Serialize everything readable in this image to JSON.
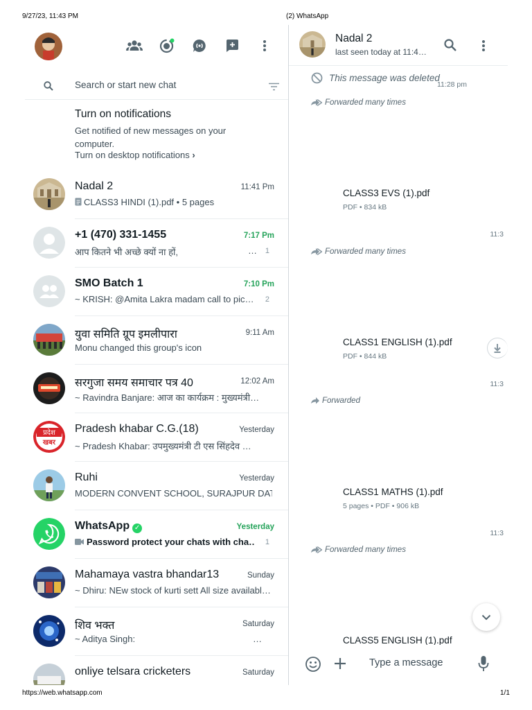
{
  "print": {
    "datetime": "9/27/23, 11:43 PM",
    "tab_title": "(2) WhatsApp",
    "url": "https://web.whatsapp.com",
    "page": "1/1"
  },
  "left_header": {
    "icons": [
      "communities-icon",
      "status-icon",
      "channels-icon",
      "new-chat-icon",
      "menu-icon"
    ]
  },
  "search": {
    "placeholder": "Search or start new chat"
  },
  "notification": {
    "title": "Turn on notifications",
    "body": "Get notified of new messages on your computer.",
    "link": "Turn on desktop notifications",
    "link_chevron": "›"
  },
  "chats": [
    {
      "name": "Nadal 2",
      "time": "11:41 Pm",
      "preview": "CLASS3 HINDI (1).pdf • 5 pages",
      "unread": ""
    },
    {
      "name": "+1 (470) 331-1455",
      "time": "7:17 Pm",
      "preview": "आप कितने भी अच्छे क्यों ना हों,",
      "preview_ellipsis": "…",
      "unread": "1"
    },
    {
      "name": "SMO Batch 1",
      "time": "7:10 Pm",
      "preview": "~ KRISH: @Amita Lakra madam call to pic…",
      "unread": "2"
    },
    {
      "name": "युवा समिति ग्रूप इमलीपारा",
      "time": "9:11 Am",
      "preview": "Monu changed this group's icon",
      "unread": ""
    },
    {
      "name": "सरगुजा समय समाचार पत्र 40",
      "time": "12:02 Am",
      "preview": "~ Ravindra Banjare: आज का कार्यक्रम : मुख्यमंत्री…",
      "unread": ""
    },
    {
      "name": "Pradesh khabar C.G.(18)",
      "time": "Yesterday",
      "preview": "~ Pradesh Khabar: उपमुख्यमंत्री टी एस सिंहदेव …",
      "unread": "",
      "avatar_text_top": "प्रदेश",
      "avatar_text_bottom": "खबर"
    },
    {
      "name": "Ruhi",
      "time": "Yesterday",
      "preview": "MODERN CONVENT SCHOOL, SURAJPUR DAT…",
      "unread": ""
    },
    {
      "name": "WhatsApp",
      "time": "Yesterday",
      "preview": "Password protect your chats with cha…",
      "unread": "1",
      "verified_mark": "✓"
    },
    {
      "name": "Mahamaya vastra bhandar13",
      "time": "Sunday",
      "preview": "~ Dhiru: NEw stock of kurti sett All size availabl…",
      "unread": ""
    },
    {
      "name": "शिव भक्त",
      "time": "Saturday",
      "preview": "~ Aditya Singh:",
      "preview_ellipsis": "…",
      "unread": ""
    },
    {
      "name": "onliye telsara cricketers",
      "time": "Saturday",
      "preview": "",
      "unread": ""
    }
  ],
  "conversation": {
    "name": "Nadal 2",
    "status": "last seen today at 11:4…",
    "messages": [
      {
        "type": "deleted",
        "text": "This message was deleted",
        "time": "11:28 pm"
      },
      {
        "type": "forward",
        "text": "Forwarded many times"
      },
      {
        "type": "document",
        "name": "CLASS3 EVS (1).pdf",
        "meta": "PDF • 834 kB",
        "time": "11:3"
      },
      {
        "type": "forward",
        "text": "Forwarded many times"
      },
      {
        "type": "document",
        "name": "CLASS1 ENGLISH (1).pdf",
        "meta": "PDF • 844 kB",
        "time": "11:3"
      },
      {
        "type": "forward",
        "text": "Forwarded"
      },
      {
        "type": "document",
        "name": "CLASS1 MATHS (1).pdf",
        "meta": "5 pages • PDF • 906 kB",
        "time": "11:3"
      },
      {
        "type": "forward",
        "text": "Forwarded many times"
      },
      {
        "type": "document",
        "name": "CLASS5 ENGLISH (1).pdf"
      }
    ]
  },
  "composer": {
    "placeholder": "Type a message"
  },
  "colors": {
    "green_accent": "#25D366",
    "green_time": "#25a35a",
    "text_primary": "#111b21",
    "text_secondary": "#3b4a54",
    "icon_grey": "#54656f",
    "divider": "#e9edef"
  }
}
